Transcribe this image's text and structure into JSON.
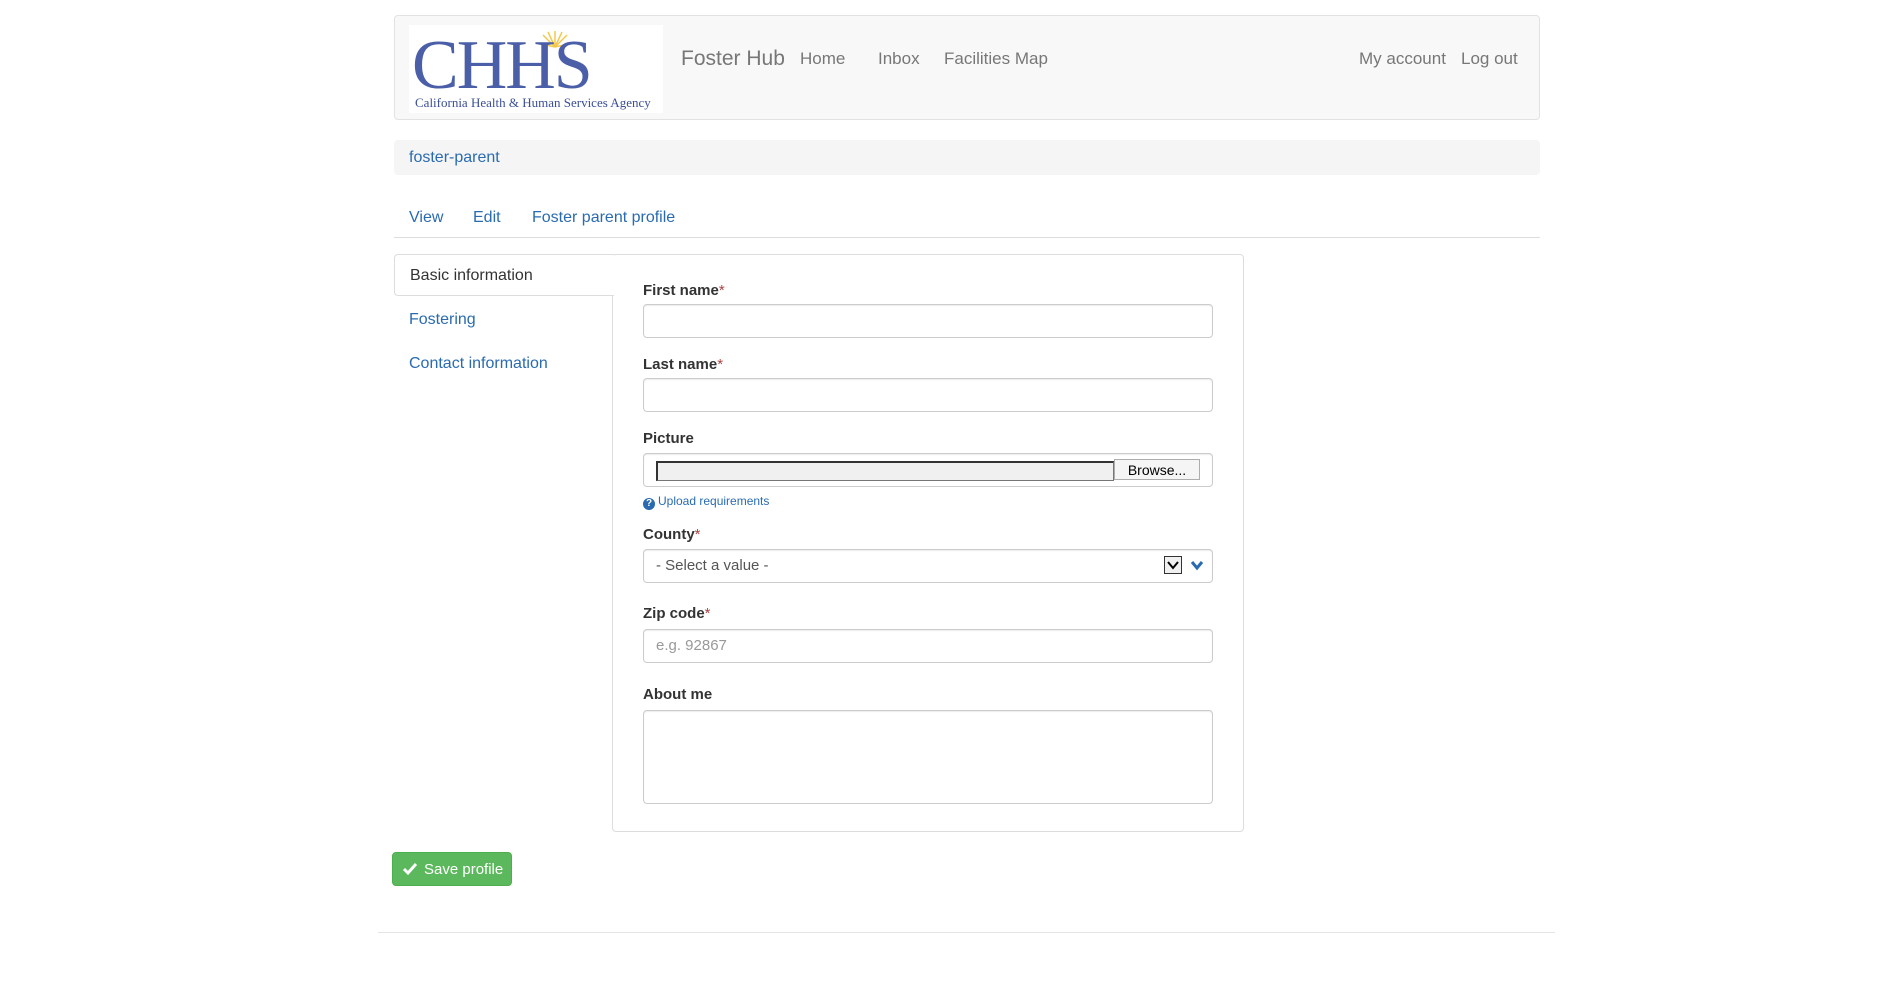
{
  "header": {
    "logo_text": "CHHS",
    "logo_subtitle": "California Health & Human Services Agency",
    "brand": "Foster Hub",
    "nav": [
      "Home",
      "Inbox",
      "Facilities Map"
    ],
    "account": "My account",
    "logout": "Log out"
  },
  "breadcrumb": "foster-parent",
  "tabs": [
    "View",
    "Edit",
    "Foster parent profile"
  ],
  "vertical_tabs": [
    "Basic information",
    "Fostering",
    "Contact information"
  ],
  "form": {
    "first_name": {
      "label": "First name",
      "required": "*",
      "value": ""
    },
    "last_name": {
      "label": "Last name",
      "required": "*",
      "value": ""
    },
    "picture": {
      "label": "Picture",
      "browse": "Browse...",
      "help": "Upload requirements"
    },
    "county": {
      "label": "County",
      "required": "*",
      "selected": "- Select a value -"
    },
    "zip": {
      "label": "Zip code",
      "required": "*",
      "placeholder": "e.g. 92867"
    },
    "about": {
      "label": "About me",
      "value": ""
    }
  },
  "save_button": "Save profile",
  "colors": {
    "link": "#2a6bb0",
    "save": "#5cb85c",
    "logo_blue": "#4a5fa8",
    "logo_sun": "#f2c94c"
  }
}
